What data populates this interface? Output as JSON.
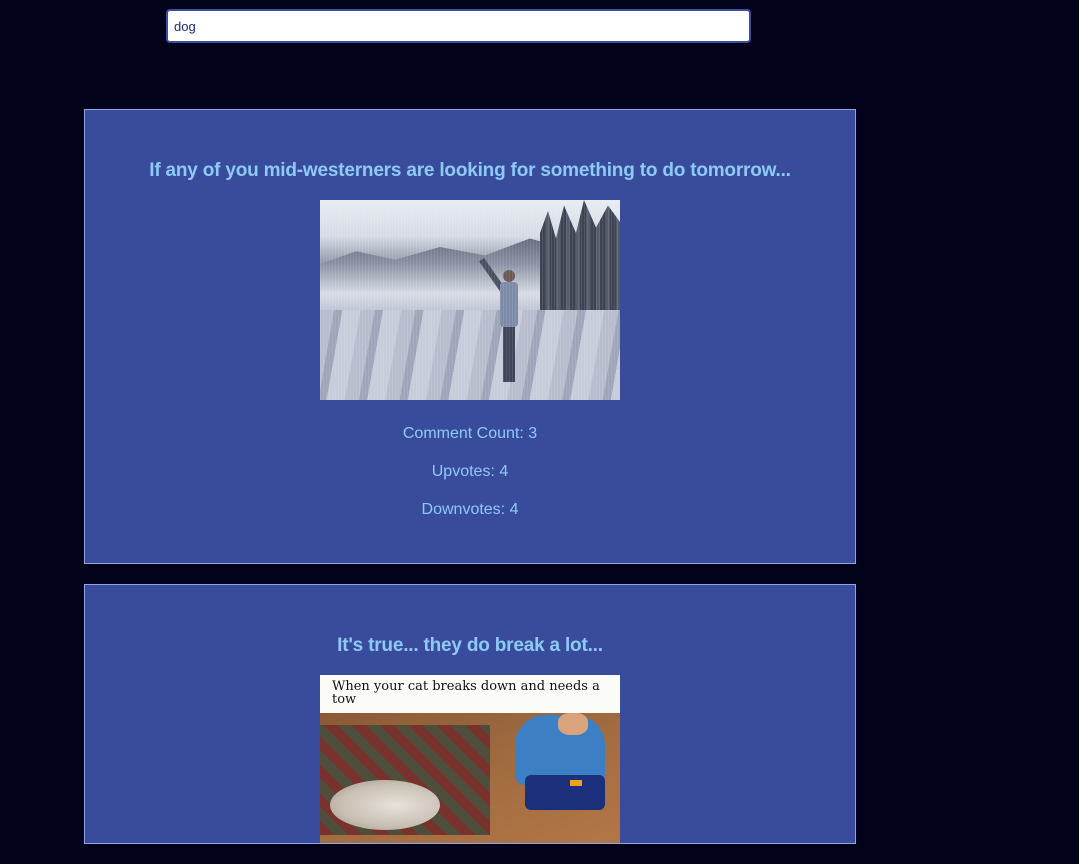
{
  "search": {
    "value": "dog"
  },
  "posts": [
    {
      "title": "If any of you mid-westerners are looking for something to do tomorrow...",
      "image_alt": "Person ice skating on a frozen lake",
      "comment_count": "Comment Count: 3",
      "upvotes": "Upvotes: 4",
      "downvotes": "Downvotes: 4"
    },
    {
      "title": "It's true... they do break a lot...",
      "image_alt": "Child with toy tow truck and cat",
      "image_caption": "When your cat breaks down and needs a tow"
    }
  ],
  "colors": {
    "page_background": "#02021a",
    "card_background": "#394c9c",
    "card_border": "#8aa6e6",
    "text_accent": "#8ecaf7"
  }
}
